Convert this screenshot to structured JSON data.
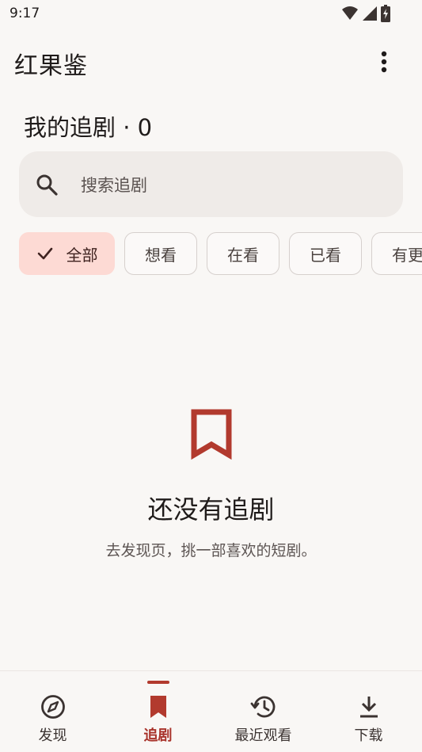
{
  "status_bar": {
    "time": "9:17"
  },
  "app_bar": {
    "title": "红果鉴"
  },
  "section": {
    "title": "我的追剧 · 0"
  },
  "search": {
    "placeholder": "搜索追剧"
  },
  "filters": [
    {
      "label": "全部",
      "selected": true
    },
    {
      "label": "想看",
      "selected": false
    },
    {
      "label": "在看",
      "selected": false
    },
    {
      "label": "已看",
      "selected": false
    },
    {
      "label": "有更",
      "selected": false
    }
  ],
  "empty_state": {
    "icon": "bookmark-icon",
    "title": "还没有追剧",
    "subtitle": "去发现页，挑一部喜欢的短剧。"
  },
  "bottom_nav": {
    "items": [
      {
        "label": "发现",
        "icon": "compass-icon",
        "active": false
      },
      {
        "label": "追剧",
        "icon": "bookmark-icon",
        "active": true
      },
      {
        "label": "最近观看",
        "icon": "history-icon",
        "active": false
      },
      {
        "label": "下载",
        "icon": "download-icon",
        "active": false
      }
    ]
  },
  "colors": {
    "accent": "#b23a2e",
    "selected_chip_bg": "#fddad4",
    "background": "#f9f7f5",
    "search_bg": "#efebe8"
  }
}
